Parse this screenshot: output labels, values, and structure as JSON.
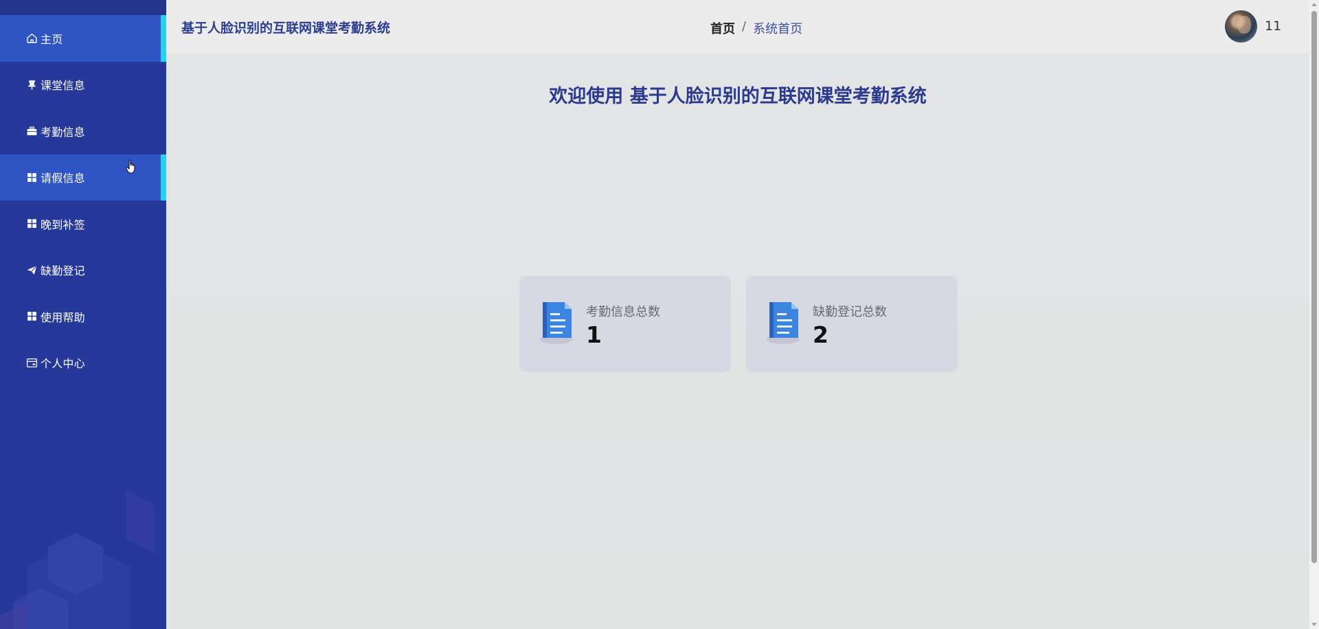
{
  "app": {
    "title": "基于人脸识别的互联网课堂考勤系统",
    "accent_color": "#26399a",
    "active_color": "#2f55c4",
    "indicator_color": "#26d1ee"
  },
  "sidebar": {
    "items": [
      {
        "label": "主页",
        "icon": "home-icon",
        "active": true
      },
      {
        "label": "课堂信息",
        "icon": "pin-icon",
        "active": false
      },
      {
        "label": "考勤信息",
        "icon": "briefcase-icon",
        "active": false
      },
      {
        "label": "请假信息",
        "icon": "grid-icon",
        "active": true
      },
      {
        "label": "晚到补签",
        "icon": "grid-icon",
        "active": false
      },
      {
        "label": "缺勤登记",
        "icon": "send-icon",
        "active": false
      },
      {
        "label": "使用帮助",
        "icon": "grid-icon",
        "active": false
      },
      {
        "label": "个人中心",
        "icon": "card-icon",
        "active": false
      }
    ]
  },
  "header": {
    "title": "基于人脸识别的互联网课堂考勤系统",
    "breadcrumb": {
      "home": "首页",
      "separator": "/",
      "current": "系统首页"
    },
    "username": "11"
  },
  "main": {
    "welcome": "欢迎使用 基于人脸识别的互联网课堂考勤系统",
    "cards": [
      {
        "label": "考勤信息总数",
        "value": "1",
        "icon": "document-icon"
      },
      {
        "label": "缺勤登记总数",
        "value": "2",
        "icon": "document-icon"
      }
    ]
  }
}
